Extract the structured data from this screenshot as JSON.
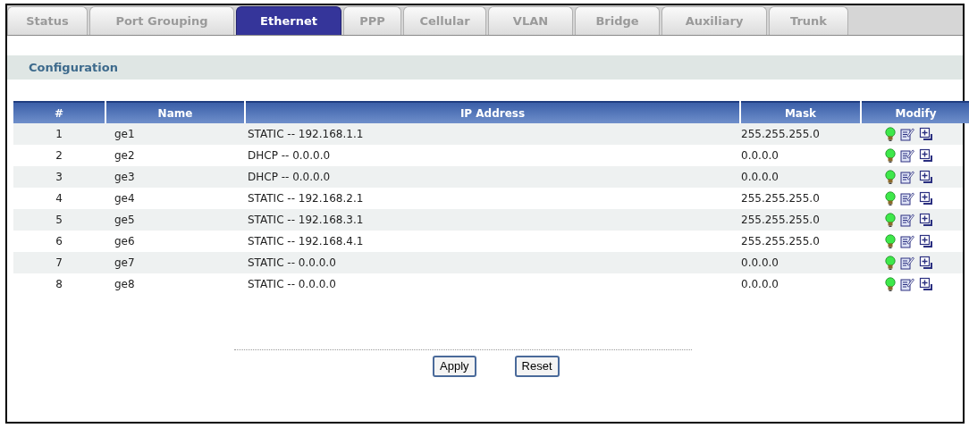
{
  "tabs": [
    {
      "label": "Status",
      "selected": false
    },
    {
      "label": "Port Grouping",
      "selected": false
    },
    {
      "label": "Ethernet",
      "selected": true
    },
    {
      "label": "PPP",
      "selected": false
    },
    {
      "label": "Cellular",
      "selected": false
    },
    {
      "label": "VLAN",
      "selected": false
    },
    {
      "label": "Bridge",
      "selected": false
    },
    {
      "label": "Auxiliary",
      "selected": false
    },
    {
      "label": "Trunk",
      "selected": false
    }
  ],
  "section_title": "Configuration",
  "table": {
    "columns": [
      "#",
      "Name",
      "IP Address",
      "Mask",
      "Modify"
    ],
    "rows": [
      {
        "index": "1",
        "name": "ge1",
        "ip_address": "STATIC -- 192.168.1.1",
        "mask": "255.255.255.0"
      },
      {
        "index": "2",
        "name": "ge2",
        "ip_address": "DHCP -- 0.0.0.0",
        "mask": "0.0.0.0"
      },
      {
        "index": "3",
        "name": "ge3",
        "ip_address": "DHCP -- 0.0.0.0",
        "mask": "0.0.0.0"
      },
      {
        "index": "4",
        "name": "ge4",
        "ip_address": "STATIC -- 192.168.2.1",
        "mask": "255.255.255.0"
      },
      {
        "index": "5",
        "name": "ge5",
        "ip_address": "STATIC -- 192.168.3.1",
        "mask": "255.255.255.0"
      },
      {
        "index": "6",
        "name": "ge6",
        "ip_address": "STATIC -- 192.168.4.1",
        "mask": "255.255.255.0"
      },
      {
        "index": "7",
        "name": "ge7",
        "ip_address": "STATIC -- 0.0.0.0",
        "mask": "0.0.0.0"
      },
      {
        "index": "8",
        "name": "ge8",
        "ip_address": "STATIC -- 0.0.0.0",
        "mask": "0.0.0.0"
      }
    ]
  },
  "buttons": [
    "Apply",
    "Reset"
  ]
}
